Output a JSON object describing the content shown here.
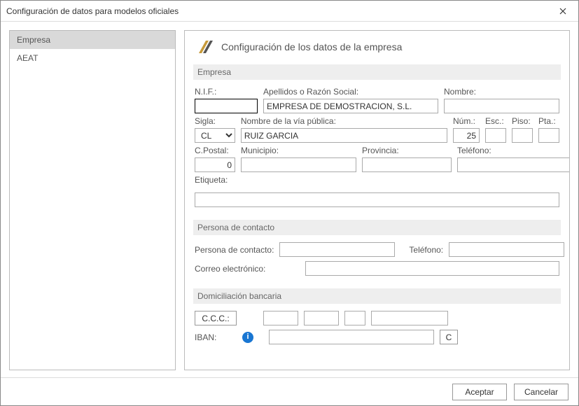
{
  "window": {
    "title": "Configuración de datos para modelos oficiales"
  },
  "sidebar": {
    "items": [
      {
        "label": "Empresa",
        "active": true
      },
      {
        "label": "AEAT",
        "active": false
      }
    ]
  },
  "page": {
    "title": "Configuración de los datos de la empresa"
  },
  "sections": {
    "empresa": {
      "header": "Empresa",
      "labels": {
        "nif": "N.I.F.:",
        "razon": "Apellidos o Razón Social:",
        "nombre": "Nombre:",
        "sigla": "Sigla:",
        "via": "Nombre de la vía pública:",
        "num": "Núm.:",
        "esc": "Esc.:",
        "piso": "Piso:",
        "pta": "Pta.:",
        "cpostal": "C.Postal:",
        "municipio": "Municipio:",
        "provincia": "Provincia:",
        "telefono": "Teléfono:",
        "etiqueta": "Etiqueta:"
      },
      "values": {
        "nif": "",
        "razon": "EMPRESA DE DEMOSTRACION, S.L.",
        "nombre": "",
        "sigla": "CL",
        "via": "RUIZ GARCIA",
        "num": "25",
        "esc": "",
        "piso": "",
        "pta": "",
        "cpostal": "0",
        "municipio": "",
        "provincia": "",
        "telefono": "",
        "etiqueta": ""
      }
    },
    "contacto": {
      "header": "Persona de contacto",
      "labels": {
        "persona": "Persona de contacto:",
        "telefono": "Teléfono:",
        "correo": "Correo electrónico:"
      },
      "values": {
        "persona": "",
        "telefono": "",
        "correo": ""
      }
    },
    "banco": {
      "header": "Domiciliación bancaria",
      "labels": {
        "ccc": "C.C.C.:",
        "iban": "IBAN:"
      },
      "values": {
        "ccc1": "",
        "ccc2": "",
        "ccc3": "",
        "ccc4": "",
        "iban": ""
      },
      "calc_button": "C"
    }
  },
  "footer": {
    "accept": "Aceptar",
    "cancel": "Cancelar"
  }
}
